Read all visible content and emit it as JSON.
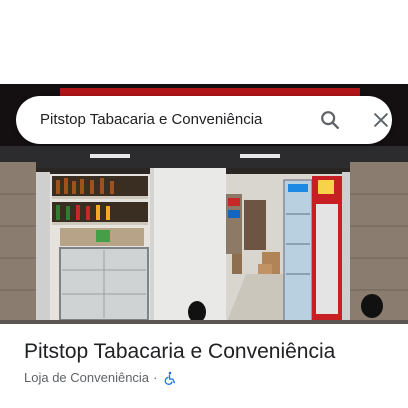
{
  "search": {
    "query": "Pitstop Tabacaria e Conveniência",
    "search_icon": "search-icon",
    "close_icon": "close-icon"
  },
  "photo": {
    "subject": "storefront-photo"
  },
  "place": {
    "title": "Pitstop Tabacaria e Conveniência",
    "category": "Loja de Conveniência",
    "separator": "·",
    "accessibility_icon": "wheelchair-icon"
  },
  "colors": {
    "accessibility_blue": "#1a73e8",
    "title_text": "#202124",
    "subtitle_text": "#5f6368"
  }
}
